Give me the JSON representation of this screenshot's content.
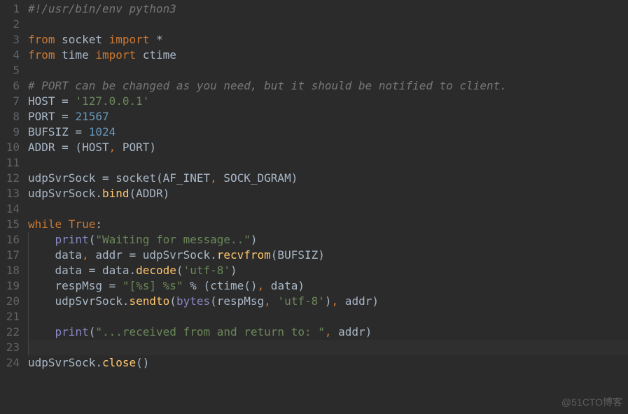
{
  "watermark": "@51CTO博客",
  "lines": [
    {
      "n": "1",
      "tokens": [
        {
          "cls": "c-comment",
          "t": "#!/usr/bin/env python3"
        }
      ]
    },
    {
      "n": "2",
      "tokens": []
    },
    {
      "n": "3",
      "tokens": [
        {
          "cls": "c-keyword",
          "t": "from"
        },
        {
          "cls": "c-plain",
          "t": " socket "
        },
        {
          "cls": "c-keyword",
          "t": "import"
        },
        {
          "cls": "c-plain",
          "t": " *"
        }
      ]
    },
    {
      "n": "4",
      "tokens": [
        {
          "cls": "c-keyword",
          "t": "from"
        },
        {
          "cls": "c-plain",
          "t": " time "
        },
        {
          "cls": "c-keyword",
          "t": "import"
        },
        {
          "cls": "c-plain",
          "t": " ctime"
        }
      ]
    },
    {
      "n": "5",
      "tokens": []
    },
    {
      "n": "6",
      "tokens": [
        {
          "cls": "c-comment",
          "t": "# PORT can be changed as you need, but it should be notified to client."
        }
      ]
    },
    {
      "n": "7",
      "tokens": [
        {
          "cls": "c-plain",
          "t": "HOST = "
        },
        {
          "cls": "c-str",
          "t": "'127.0.0.1'"
        }
      ]
    },
    {
      "n": "8",
      "tokens": [
        {
          "cls": "c-plain",
          "t": "PORT = "
        },
        {
          "cls": "c-num",
          "t": "21567"
        }
      ]
    },
    {
      "n": "9",
      "tokens": [
        {
          "cls": "c-plain",
          "t": "BUFSIZ = "
        },
        {
          "cls": "c-num",
          "t": "1024"
        }
      ]
    },
    {
      "n": "10",
      "tokens": [
        {
          "cls": "c-plain",
          "t": "ADDR = (HOST"
        },
        {
          "cls": "c-keyword",
          "t": ","
        },
        {
          "cls": "c-plain",
          "t": " PORT)"
        }
      ]
    },
    {
      "n": "11",
      "tokens": []
    },
    {
      "n": "12",
      "tokens": [
        {
          "cls": "c-plain",
          "t": "udpSvrSock = socket(AF_INET"
        },
        {
          "cls": "c-keyword",
          "t": ","
        },
        {
          "cls": "c-plain",
          "t": " SOCK_DGRAM)"
        }
      ]
    },
    {
      "n": "13",
      "tokens": [
        {
          "cls": "c-plain",
          "t": "udpSvrSock."
        },
        {
          "cls": "c-func",
          "t": "bind"
        },
        {
          "cls": "c-plain",
          "t": "(ADDR)"
        }
      ]
    },
    {
      "n": "14",
      "tokens": []
    },
    {
      "n": "15",
      "tokens": [
        {
          "cls": "c-keyword",
          "t": "while "
        },
        {
          "cls": "c-keyword",
          "t": "True"
        },
        {
          "cls": "c-plain",
          "t": ":"
        }
      ]
    },
    {
      "n": "16",
      "guide": true,
      "tokens": [
        {
          "cls": "c-plain",
          "t": "    "
        },
        {
          "cls": "c-builtin",
          "t": "print"
        },
        {
          "cls": "c-plain",
          "t": "("
        },
        {
          "cls": "c-str",
          "t": "\"Waiting for message..\""
        },
        {
          "cls": "c-plain",
          "t": ")"
        }
      ]
    },
    {
      "n": "17",
      "guide": true,
      "tokens": [
        {
          "cls": "c-plain",
          "t": "    data"
        },
        {
          "cls": "c-keyword",
          "t": ","
        },
        {
          "cls": "c-plain",
          "t": " addr = udpSvrSock."
        },
        {
          "cls": "c-func",
          "t": "recvfrom"
        },
        {
          "cls": "c-plain",
          "t": "(BUFSIZ)"
        }
      ]
    },
    {
      "n": "18",
      "guide": true,
      "tokens": [
        {
          "cls": "c-plain",
          "t": "    data = data."
        },
        {
          "cls": "c-func",
          "t": "decode"
        },
        {
          "cls": "c-plain",
          "t": "("
        },
        {
          "cls": "c-str",
          "t": "'utf-8'"
        },
        {
          "cls": "c-plain",
          "t": ")"
        }
      ]
    },
    {
      "n": "19",
      "guide": true,
      "tokens": [
        {
          "cls": "c-plain",
          "t": "    respMsg = "
        },
        {
          "cls": "c-str",
          "t": "\"[%s] %s\""
        },
        {
          "cls": "c-plain",
          "t": " % (ctime()"
        },
        {
          "cls": "c-keyword",
          "t": ","
        },
        {
          "cls": "c-plain",
          "t": " data)"
        }
      ]
    },
    {
      "n": "20",
      "guide": true,
      "tokens": [
        {
          "cls": "c-plain",
          "t": "    udpSvrSock."
        },
        {
          "cls": "c-func",
          "t": "sendto"
        },
        {
          "cls": "c-plain",
          "t": "("
        },
        {
          "cls": "c-builtin",
          "t": "bytes"
        },
        {
          "cls": "c-plain",
          "t": "(respMsg"
        },
        {
          "cls": "c-keyword",
          "t": ","
        },
        {
          "cls": "c-plain",
          "t": " "
        },
        {
          "cls": "c-str",
          "t": "'utf-8'"
        },
        {
          "cls": "c-plain",
          "t": ")"
        },
        {
          "cls": "c-keyword",
          "t": ","
        },
        {
          "cls": "c-plain",
          "t": " addr)"
        }
      ]
    },
    {
      "n": "21",
      "guide": true,
      "tokens": []
    },
    {
      "n": "22",
      "guide": true,
      "tokens": [
        {
          "cls": "c-plain",
          "t": "    "
        },
        {
          "cls": "c-builtin",
          "t": "print"
        },
        {
          "cls": "c-plain",
          "t": "("
        },
        {
          "cls": "c-str",
          "t": "\"...received from and return to: \""
        },
        {
          "cls": "c-keyword",
          "t": ","
        },
        {
          "cls": "c-plain",
          "t": " addr)"
        }
      ]
    },
    {
      "n": "23",
      "guide": true,
      "cursor": true,
      "tokens": []
    },
    {
      "n": "24",
      "tokens": [
        {
          "cls": "c-plain",
          "t": "udpSvrSock."
        },
        {
          "cls": "c-func",
          "t": "close"
        },
        {
          "cls": "c-plain",
          "t": "()"
        }
      ]
    }
  ]
}
